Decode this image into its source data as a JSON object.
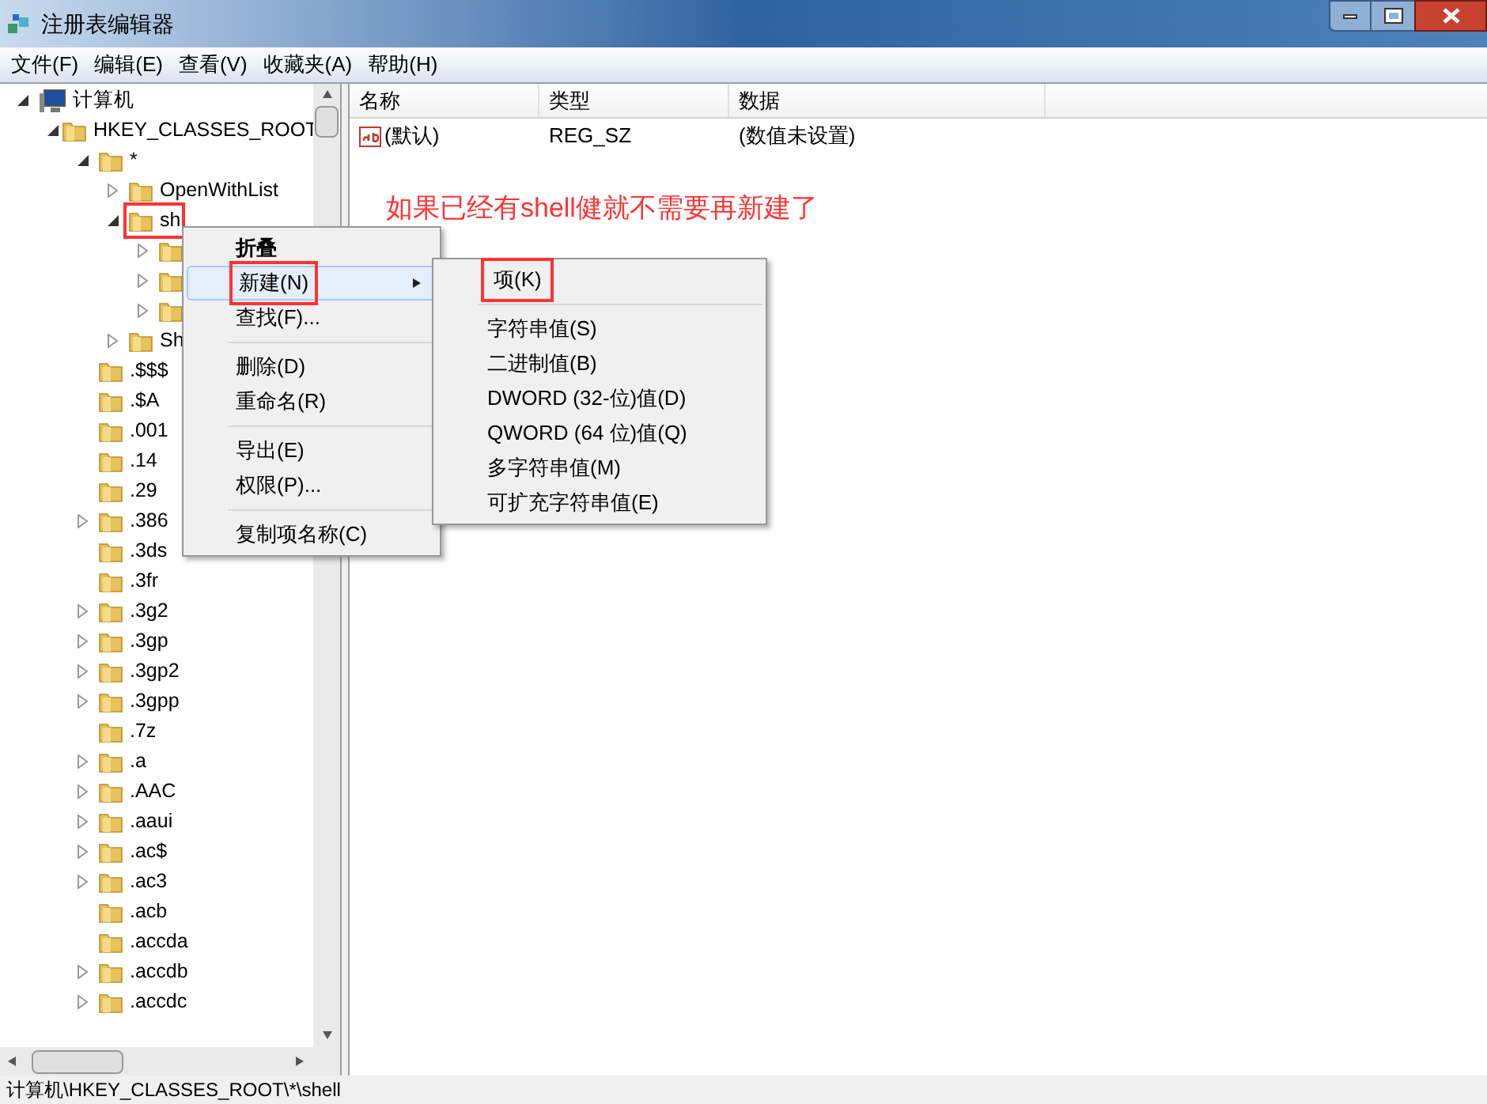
{
  "window": {
    "title": "注册表编辑器"
  },
  "menu_bar": [
    "文件(F)",
    "编辑(E)",
    "查看(V)",
    "收藏夹(A)",
    "帮助(H)"
  ],
  "tree": [
    {
      "label": "计算机",
      "kind": "computer",
      "expandable": true,
      "expanded": true,
      "highlighted": false,
      "children": [
        {
          "label": "HKEY_CLASSES_ROOT",
          "kind": "folder",
          "expandable": true,
          "expanded": true,
          "highlighted": false,
          "children": [
            {
              "label": "*",
              "kind": "folder",
              "expandable": true,
              "expanded": true,
              "highlighted": false,
              "children": [
                {
                  "label": "OpenWithList",
                  "kind": "folder",
                  "expandable": true,
                  "expanded": false,
                  "highlighted": false
                },
                {
                  "label": "sh",
                  "kind": "folder",
                  "expandable": true,
                  "expanded": true,
                  "highlighted": true,
                  "children": [
                    {
                      "kind": "folder",
                      "expandable": true,
                      "expanded": false,
                      "highlighted": false
                    },
                    {
                      "kind": "folder",
                      "expandable": true,
                      "expanded": false,
                      "highlighted": false
                    },
                    {
                      "kind": "folder",
                      "expandable": true,
                      "expanded": false,
                      "highlighted": false
                    }
                  ]
                },
                {
                  "label": "Sh",
                  "kind": "folder",
                  "expandable": true,
                  "expanded": false,
                  "highlighted": false
                }
              ]
            },
            {
              "label": ".$$$",
              "kind": "folder",
              "expandable": false,
              "highlighted": false
            },
            {
              "label": ".$A",
              "kind": "folder",
              "expandable": false,
              "highlighted": false
            },
            {
              "label": ".001",
              "kind": "folder",
              "expandable": false,
              "highlighted": false
            },
            {
              "label": ".14",
              "kind": "folder",
              "expandable": false,
              "highlighted": false
            },
            {
              "label": ".29",
              "kind": "folder",
              "expandable": false,
              "highlighted": false
            },
            {
              "label": ".386",
              "kind": "folder",
              "expandable": true,
              "expanded": false,
              "highlighted": false
            },
            {
              "label": ".3ds",
              "kind": "folder",
              "expandable": false,
              "highlighted": false
            },
            {
              "label": ".3fr",
              "kind": "folder",
              "expandable": false,
              "highlighted": false
            },
            {
              "label": ".3g2",
              "kind": "folder",
              "expandable": true,
              "expanded": false,
              "highlighted": false
            },
            {
              "label": ".3gp",
              "kind": "folder",
              "expandable": true,
              "expanded": false,
              "highlighted": false
            },
            {
              "label": ".3gp2",
              "kind": "folder",
              "expandable": true,
              "expanded": false,
              "highlighted": false
            },
            {
              "label": ".3gpp",
              "kind": "folder",
              "expandable": true,
              "expanded": false,
              "highlighted": false
            },
            {
              "label": ".7z",
              "kind": "folder",
              "expandable": false,
              "highlighted": false
            },
            {
              "label": ".a",
              "kind": "folder",
              "expandable": true,
              "expanded": false,
              "highlighted": false
            },
            {
              "label": ".AAC",
              "kind": "folder",
              "expandable": true,
              "expanded": false,
              "highlighted": false
            },
            {
              "label": ".aaui",
              "kind": "folder",
              "expandable": true,
              "expanded": false,
              "highlighted": false
            },
            {
              "label": ".ac$",
              "kind": "folder",
              "expandable": true,
              "expanded": false,
              "highlighted": false
            },
            {
              "label": ".ac3",
              "kind": "folder",
              "expandable": true,
              "expanded": false,
              "highlighted": false
            },
            {
              "label": ".acb",
              "kind": "folder",
              "expandable": false,
              "highlighted": false
            },
            {
              "label": ".accda",
              "kind": "folder",
              "expandable": false,
              "highlighted": false
            },
            {
              "label": ".accdb",
              "kind": "folder",
              "expandable": true,
              "expanded": false,
              "highlighted": false
            },
            {
              "label": ".accdc",
              "kind": "folder",
              "expandable": true,
              "expanded": false,
              "highlighted": false
            }
          ]
        }
      ]
    }
  ],
  "values_table": {
    "columns": [
      "名称",
      "类型",
      "数据"
    ],
    "rows": [
      {
        "name": "(默认)",
        "type": "REG_SZ",
        "data": "(数值未设置)"
      }
    ]
  },
  "context_menu": [
    {
      "kind": "item",
      "label": "折叠",
      "bold": true,
      "selected": false,
      "submenu": false,
      "highlighted": false
    },
    {
      "kind": "item",
      "label": "新建(N)",
      "bold": false,
      "selected": true,
      "submenu": true,
      "highlighted": true
    },
    {
      "kind": "item",
      "label": "查找(F)...",
      "bold": false,
      "selected": false,
      "submenu": false,
      "highlighted": false
    },
    {
      "kind": "separator"
    },
    {
      "kind": "item",
      "label": "删除(D)",
      "bold": false,
      "selected": false,
      "submenu": false,
      "highlighted": false
    },
    {
      "kind": "item",
      "label": "重命名(R)",
      "bold": false,
      "selected": false,
      "submenu": false,
      "highlighted": false
    },
    {
      "kind": "separator"
    },
    {
      "kind": "item",
      "label": "导出(E)",
      "bold": false,
      "selected": false,
      "submenu": false,
      "highlighted": false
    },
    {
      "kind": "item",
      "label": "权限(P)...",
      "bold": false,
      "selected": false,
      "submenu": false,
      "highlighted": false
    },
    {
      "kind": "separator"
    },
    {
      "kind": "item",
      "label": "复制项名称(C)",
      "bold": false,
      "selected": false,
      "submenu": false,
      "highlighted": false
    }
  ],
  "submenu": [
    {
      "kind": "item",
      "label": "项(K)",
      "highlighted": true
    },
    {
      "kind": "separator"
    },
    {
      "kind": "item",
      "label": "字符串值(S)",
      "highlighted": false
    },
    {
      "kind": "item",
      "label": "二进制值(B)",
      "highlighted": false
    },
    {
      "kind": "item",
      "label": "DWORD (32-位)值(D)",
      "highlighted": false
    },
    {
      "kind": "item",
      "label": "QWORD (64 位)值(Q)",
      "highlighted": false
    },
    {
      "kind": "item",
      "label": "多字符串值(M)",
      "highlighted": false
    },
    {
      "kind": "item",
      "label": "可扩充字符串值(E)",
      "highlighted": false
    }
  ],
  "annotation": {
    "text": "如果已经有shell健就不需要再新建了"
  },
  "status_bar": "计算机\\HKEY_CLASSES_ROOT\\*\\shell"
}
